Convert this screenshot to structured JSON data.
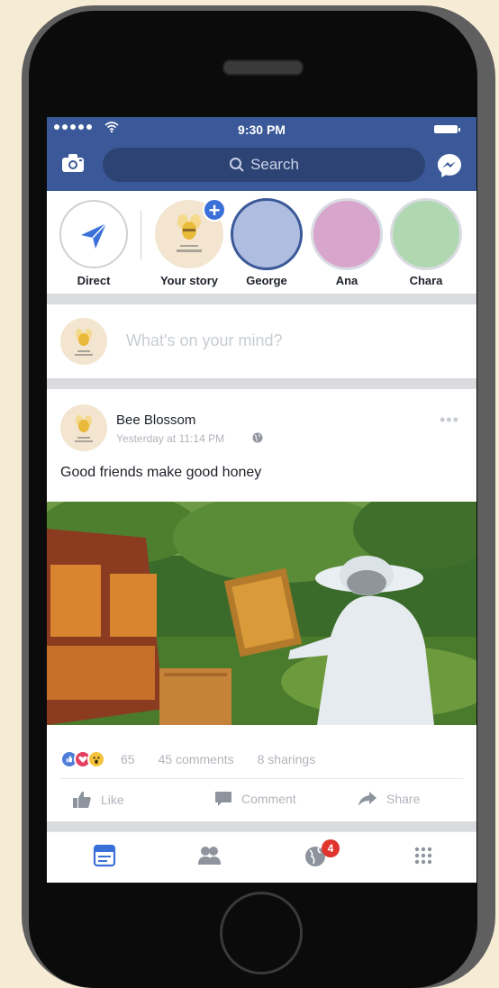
{
  "status": {
    "time": "9:30 PM"
  },
  "header": {
    "search_label": "Search"
  },
  "stories": [
    {
      "label": "Direct"
    },
    {
      "label": "Your story"
    },
    {
      "label": "George"
    },
    {
      "label": "Ana"
    },
    {
      "label": "Chara"
    }
  ],
  "composer": {
    "placeholder": "What's on your mind?"
  },
  "post": {
    "author": "Bee Blossom",
    "timestamp": "Yesterday at 11:14 PM",
    "text": "Good friends make good honey",
    "reaction_count": "65",
    "comments": "45 comments",
    "sharings": "8 sharings",
    "like_label": "Like",
    "comment_label": "Comment",
    "share_label": "Share"
  },
  "tabbar": {
    "notification_count": "4"
  },
  "colors": {
    "brand": "#3b5998",
    "badge": "#e0342c",
    "story_george": "#aebde0",
    "story_ana": "#d8a5cc",
    "story_chara": "#b0d8b0"
  }
}
